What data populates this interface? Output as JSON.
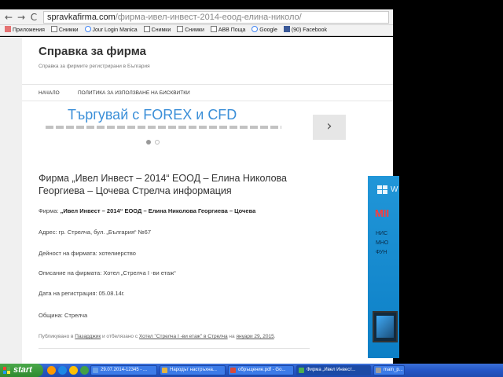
{
  "browser": {
    "url_domain": "spravkafirma.com",
    "url_path": "/фирма-ивел-инвест-2014-еоод-елина-николо/",
    "back_glyph": "←",
    "forward_glyph": "→",
    "reload_glyph": "C",
    "bookmarks": [
      {
        "label": "Приложения",
        "icon": "apps-icon"
      },
      {
        "label": "Снимки",
        "icon": "page-icon"
      },
      {
        "label": "Jour Login Manica",
        "icon": "google-icon"
      },
      {
        "label": "Снимки",
        "icon": "page-icon"
      },
      {
        "label": "Снимки",
        "icon": "page-icon"
      },
      {
        "label": "ABB Поща",
        "icon": "home-icon"
      },
      {
        "label": "Google",
        "icon": "google-icon"
      },
      {
        "label": "(90) Facebook",
        "icon": "facebook-icon"
      }
    ]
  },
  "site": {
    "title": "Справка за фирма",
    "tagline": "Справка за фирмите регистрирани в България",
    "nav": [
      "НАЧАЛО",
      "ПОЛИТИКА ЗА ИЗПОЛЗВАНЕ НА БИСКВИТКИ"
    ]
  },
  "slider": {
    "headline": "Търгувай с FOREX и CFD",
    "next_glyph": "›"
  },
  "article": {
    "title": "Фирма „Ивел Инвест – 2014“ ЕООД – Елина Николова Георгиева – Цочева Стрелча информация",
    "company_label": "Фирма:",
    "company_value": "„Ивел Инвест – 2014“ ЕООД – Елина Николова Георгиева – Цочева",
    "address": "Адрес:  гр. Стрелча, бул. „България“ №67",
    "activity": "Дейност на фирмата: хотелиерство",
    "description": "Описание на фирмата:  Хотел „Стрелча I -ви етаж“",
    "reg_date": "Дата на регистрация: 05.08.14г.",
    "municipality": "Община:  Стрелча",
    "published_prefix": "Публикувано в ",
    "published_category": "Пазарджик",
    "published_mid": " и отбелязано с ",
    "published_tag": "Хотел \"Стрелча I -ви етаж\" в Стрелча",
    "published_on": " на ",
    "published_date": "януари 29, 2015",
    "published_end": "."
  },
  "ad": {
    "brand_letter": "W",
    "headline": "MII",
    "lines": [
      "НИС",
      "МНО",
      "ФУН"
    ]
  },
  "taskbar": {
    "start_label": "start",
    "tasks": [
      {
        "label": "29.07.2014-12345 - ...",
        "color": "#6aa0e8"
      },
      {
        "label": "Народът настръхна...",
        "color": "#e3b341"
      },
      {
        "label": "обръщение.pdf - Go...",
        "color": "#d84a3a"
      },
      {
        "label": "Фирма „Ивел Инвест...",
        "color": "#4caf50"
      },
      {
        "label": "main_p...",
        "color": "#9e9e9e"
      }
    ]
  },
  "colors": {
    "accent_blue": "#3b8fd8",
    "ad_blue": "#1e90d4",
    "ad_red": "#ff3b3b",
    "taskbar_blue": "#2456c6",
    "start_green": "#3a9a3a"
  }
}
